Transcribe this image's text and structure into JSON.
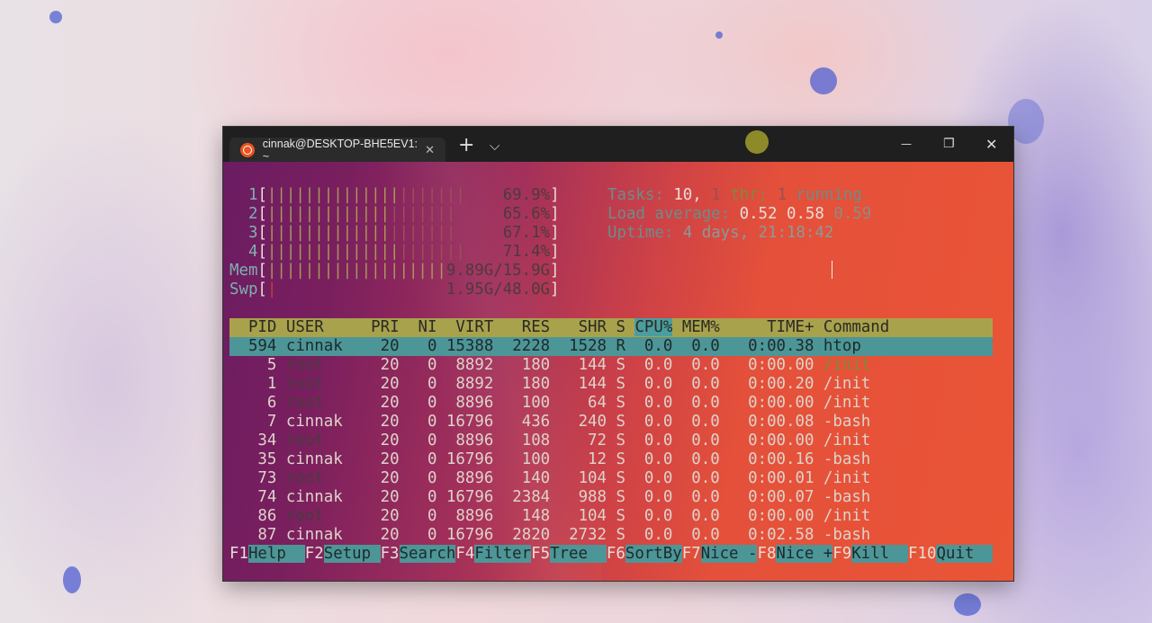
{
  "window": {
    "tab_title": "cinnak@DESKTOP-BHE5EV1: ~",
    "tab_close": "✕",
    "new_tab": "+",
    "dropdown": "⌵",
    "minimize": "—",
    "maximize": "❐",
    "close": "✕"
  },
  "meters": [
    {
      "label": "1",
      "value": "69.9%",
      "fraction": 0.699
    },
    {
      "label": "2",
      "value": "65.6%",
      "fraction": 0.656
    },
    {
      "label": "3",
      "value": "67.1%",
      "fraction": 0.671
    },
    {
      "label": "4",
      "value": "71.4%",
      "fraction": 0.714
    },
    {
      "label": "Mem",
      "value": "9.89G/15.9G",
      "fraction": 0.622
    },
    {
      "label": "Swp",
      "value": "1.95G/48.0G",
      "fraction": 0.041
    }
  ],
  "summary": {
    "tasks_label": "Tasks:",
    "tasks": "10,",
    "thr_count": "1",
    "thr_label": "thr;",
    "running_count": "1",
    "running_label": "running",
    "load_label": "Load average:",
    "load1": "0.52",
    "load5": "0.58",
    "load15": "0.59",
    "uptime_label": "Uptime:",
    "uptime": "4 days, 21:18:42"
  },
  "columns": [
    "PID",
    "USER",
    "PRI",
    "NI",
    "VIRT",
    "RES",
    "SHR",
    "S",
    "CPU%",
    "MEM%",
    "TIME+",
    "Command"
  ],
  "processes": [
    {
      "pid": "594",
      "user": "cinnak",
      "pri": "20",
      "ni": "0",
      "virt": "15388",
      "res": "2228",
      "shr": "1528",
      "s": "R",
      "cpu": "0.0",
      "mem": "0.0",
      "time": "0:00.38",
      "cmd": "htop"
    },
    {
      "pid": "5",
      "user": "root",
      "pri": "20",
      "ni": "0",
      "virt": "8892",
      "res": "180",
      "shr": "144",
      "s": "S",
      "cpu": "0.0",
      "mem": "0.0",
      "time": "0:00.00",
      "cmd": "/init"
    },
    {
      "pid": "1",
      "user": "root",
      "pri": "20",
      "ni": "0",
      "virt": "8892",
      "res": "180",
      "shr": "144",
      "s": "S",
      "cpu": "0.0",
      "mem": "0.0",
      "time": "0:00.20",
      "cmd": "/init"
    },
    {
      "pid": "6",
      "user": "root",
      "pri": "20",
      "ni": "0",
      "virt": "8896",
      "res": "100",
      "shr": "64",
      "s": "S",
      "cpu": "0.0",
      "mem": "0.0",
      "time": "0:00.00",
      "cmd": "/init"
    },
    {
      "pid": "7",
      "user": "cinnak",
      "pri": "20",
      "ni": "0",
      "virt": "16796",
      "res": "436",
      "shr": "240",
      "s": "S",
      "cpu": "0.0",
      "mem": "0.0",
      "time": "0:00.08",
      "cmd": "-bash"
    },
    {
      "pid": "34",
      "user": "root",
      "pri": "20",
      "ni": "0",
      "virt": "8896",
      "res": "108",
      "shr": "72",
      "s": "S",
      "cpu": "0.0",
      "mem": "0.0",
      "time": "0:00.00",
      "cmd": "/init"
    },
    {
      "pid": "35",
      "user": "cinnak",
      "pri": "20",
      "ni": "0",
      "virt": "16796",
      "res": "100",
      "shr": "12",
      "s": "S",
      "cpu": "0.0",
      "mem": "0.0",
      "time": "0:00.16",
      "cmd": "-bash"
    },
    {
      "pid": "73",
      "user": "root",
      "pri": "20",
      "ni": "0",
      "virt": "8896",
      "res": "140",
      "shr": "104",
      "s": "S",
      "cpu": "0.0",
      "mem": "0.0",
      "time": "0:00.01",
      "cmd": "/init"
    },
    {
      "pid": "74",
      "user": "cinnak",
      "pri": "20",
      "ni": "0",
      "virt": "16796",
      "res": "2384",
      "shr": "988",
      "s": "S",
      "cpu": "0.0",
      "mem": "0.0",
      "time": "0:00.07",
      "cmd": "-bash"
    },
    {
      "pid": "86",
      "user": "root",
      "pri": "20",
      "ni": "0",
      "virt": "8896",
      "res": "148",
      "shr": "104",
      "s": "S",
      "cpu": "0.0",
      "mem": "0.0",
      "time": "0:00.00",
      "cmd": "/init"
    },
    {
      "pid": "87",
      "user": "cinnak",
      "pri": "20",
      "ni": "0",
      "virt": "16796",
      "res": "2820",
      "shr": "2732",
      "s": "S",
      "cpu": "0.0",
      "mem": "0.0",
      "time": "0:02.58",
      "cmd": "-bash"
    }
  ],
  "fkeys": [
    {
      "key": "F1",
      "label": "Help  "
    },
    {
      "key": "F2",
      "label": "Setup "
    },
    {
      "key": "F3",
      "label": "Search"
    },
    {
      "key": "F4",
      "label": "Filter"
    },
    {
      "key": "F5",
      "label": "Tree  "
    },
    {
      "key": "F6",
      "label": "SortBy"
    },
    {
      "key": "F7",
      "label": "Nice -"
    },
    {
      "key": "F8",
      "label": "Nice +"
    },
    {
      "key": "F9",
      "label": "Kill  "
    },
    {
      "key": "F10",
      "label": "Quit  "
    }
  ]
}
